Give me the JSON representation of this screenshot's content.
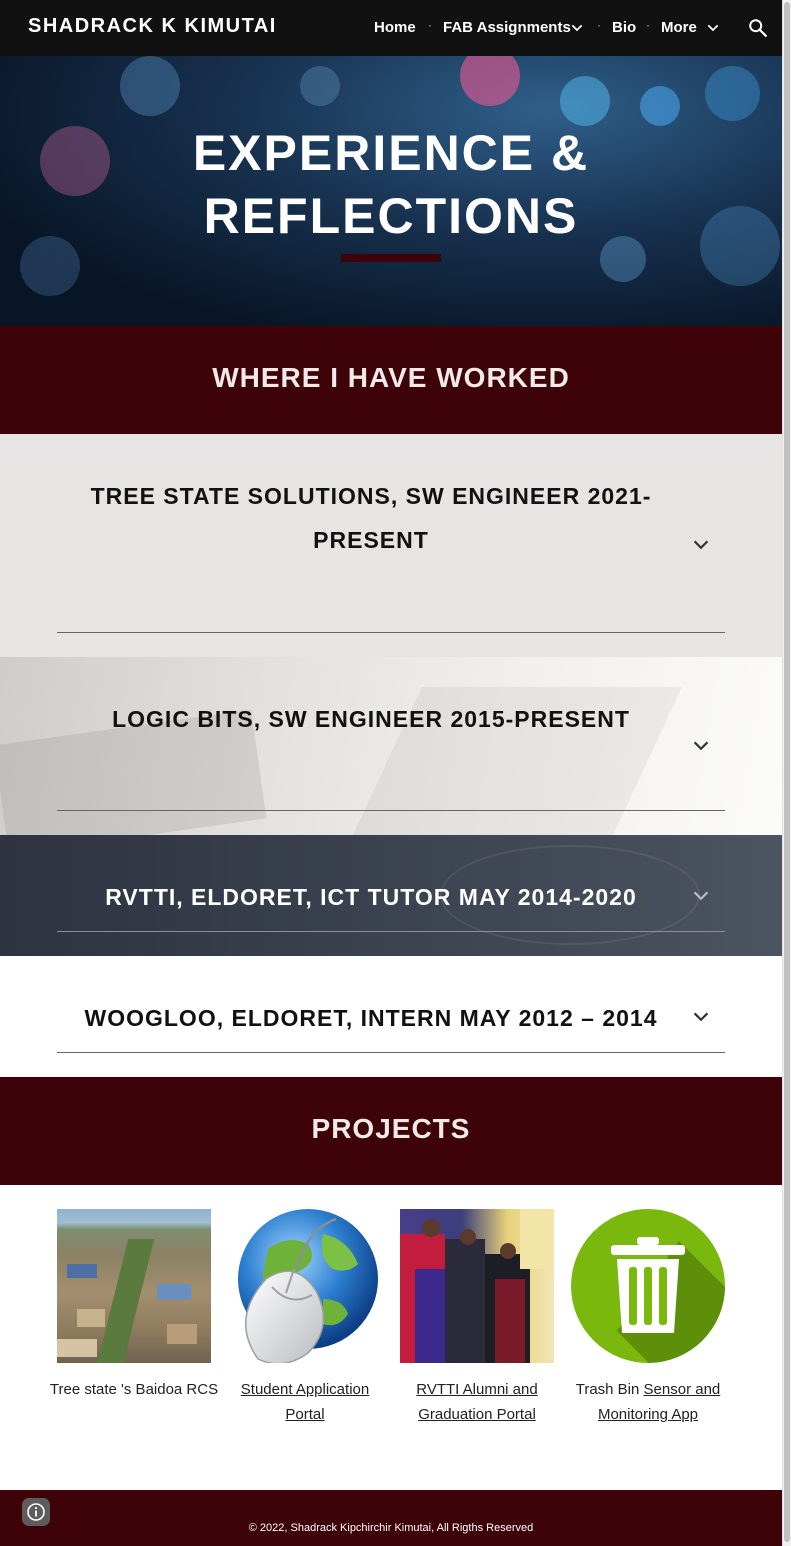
{
  "nav": {
    "site_title": "SHADRACK K KIMUTAI",
    "items": [
      {
        "label": "Home"
      },
      {
        "label": "FAB Assignments"
      },
      {
        "label": "Bio"
      },
      {
        "label": "More"
      }
    ],
    "separator": "·"
  },
  "hero": {
    "title_line1": "EXPERIENCE &",
    "title_line2": "REFLECTIONS"
  },
  "work": {
    "heading": "WHERE I HAVE WORKED",
    "jobs": [
      {
        "title_line1": "TREE STATE SOLUTIONS, SW ENGINEER 2021-",
        "title_line2": "PRESENT"
      },
      {
        "title_line1": "LOGIC BITS, SW ENGINEER 2015-PRESENT"
      },
      {
        "title_line1": "RVTTI, ELDORET, ICT TUTOR MAY 2014-2020"
      },
      {
        "title_line1": "WOOGLOO, ELDORET, INTERN MAY 2012 –  2014"
      }
    ]
  },
  "projects": {
    "heading": "PROJECTS",
    "items": [
      {
        "caption_plain": "Tree state 's Baidoa RCS",
        "caption_link": ""
      },
      {
        "caption_plain": "",
        "caption_link": "Student Application Portal"
      },
      {
        "caption_plain": "",
        "caption_link": "RVTTI Alumni and Graduation Portal"
      },
      {
        "caption_plain": "Trash Bin ",
        "caption_link": "Sensor and Monitoring App"
      }
    ]
  },
  "footer": {
    "copyright": "© 2022, Shadrack Kipchirchir Kimutai, All Rigths Reserved"
  },
  "colors": {
    "nav_bg": "#111111",
    "accent_maroon": "#3e0309",
    "accordion_grey": "#e7e4e4",
    "trash_green": "#7ab80e"
  }
}
